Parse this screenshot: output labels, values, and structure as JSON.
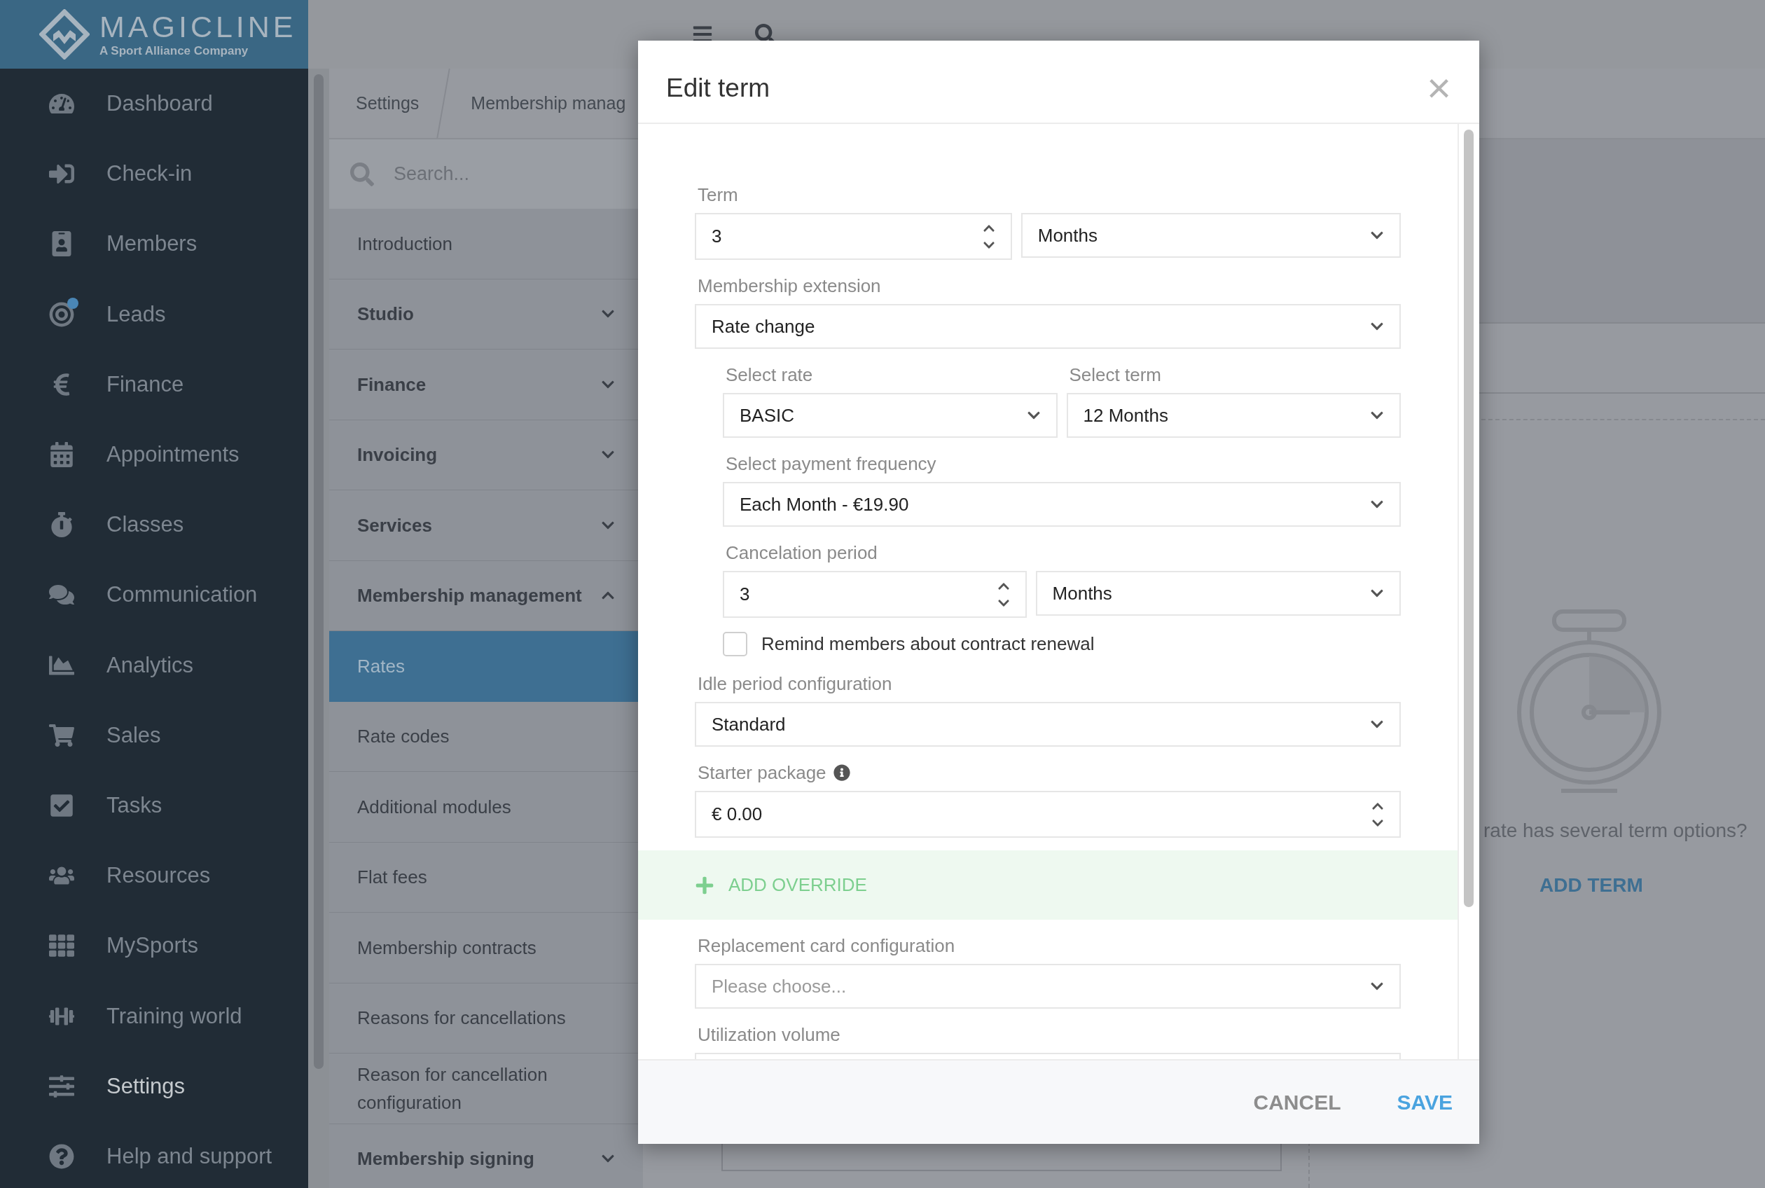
{
  "brand": {
    "name": "MAGICLINE",
    "tagline": "A Sport Alliance Company"
  },
  "sidebar": {
    "items": [
      {
        "label": "Dashboard",
        "selected": false,
        "notification": false
      },
      {
        "label": "Check-in",
        "selected": false,
        "notification": false
      },
      {
        "label": "Members",
        "selected": false,
        "notification": false
      },
      {
        "label": "Leads",
        "selected": false,
        "notification": true
      },
      {
        "label": "Finance",
        "selected": false,
        "notification": false
      },
      {
        "label": "Appointments",
        "selected": false,
        "notification": false
      },
      {
        "label": "Classes",
        "selected": false,
        "notification": false
      },
      {
        "label": "Communication",
        "selected": false,
        "notification": false
      },
      {
        "label": "Analytics",
        "selected": false,
        "notification": false
      },
      {
        "label": "Sales",
        "selected": false,
        "notification": false
      },
      {
        "label": "Tasks",
        "selected": false,
        "notification": false
      },
      {
        "label": "Resources",
        "selected": false,
        "notification": false
      },
      {
        "label": "MySports",
        "selected": false,
        "notification": false
      },
      {
        "label": "Training world",
        "selected": false,
        "notification": false
      },
      {
        "label": "Settings",
        "selected": true,
        "notification": false
      },
      {
        "label": "Help and support",
        "selected": false,
        "notification": false
      }
    ]
  },
  "breadcrumb": [
    "Settings",
    "Membership manag"
  ],
  "settings_nav": {
    "search": {
      "placeholder": "Search..."
    },
    "items": [
      {
        "label": "Introduction",
        "kind": "link",
        "selected": false
      },
      {
        "label": "Studio",
        "kind": "group",
        "selected": false,
        "expanded": false
      },
      {
        "label": "Finance",
        "kind": "group",
        "selected": false,
        "expanded": false
      },
      {
        "label": "Invoicing",
        "kind": "group",
        "selected": false,
        "expanded": false
      },
      {
        "label": "Services",
        "kind": "group",
        "selected": false,
        "expanded": false
      },
      {
        "label": "Membership management",
        "kind": "group",
        "selected": false,
        "expanded": true
      },
      {
        "label": "Rates",
        "kind": "link",
        "selected": true
      },
      {
        "label": "Rate codes",
        "kind": "link",
        "selected": false
      },
      {
        "label": "Additional modules",
        "kind": "link",
        "selected": false
      },
      {
        "label": "Flat fees",
        "kind": "link",
        "selected": false
      },
      {
        "label": "Membership contracts",
        "kind": "link",
        "selected": false
      },
      {
        "label": "Reasons for cancellations",
        "kind": "link",
        "selected": false
      },
      {
        "label": "Reason for cancellation configuration",
        "kind": "link",
        "selected": false
      },
      {
        "label": "Membership signing",
        "kind": "group",
        "selected": false,
        "expanded": false
      }
    ]
  },
  "main": {
    "prompt": "rate has several term options?",
    "add_term": "ADD TERM"
  },
  "modal": {
    "title": "Edit term",
    "close": "×",
    "fields": [
      {
        "kind": "number_unit",
        "label": "Term",
        "value": "3",
        "unit": "Months"
      },
      {
        "kind": "select",
        "label": "Membership extension",
        "value": "Rate change",
        "children": [
          {
            "kind": "pair",
            "fields": [
              {
                "label": "Select rate",
                "value": "BASIC"
              },
              {
                "label": "Select term",
                "value": "12 Months"
              }
            ]
          },
          {
            "kind": "select",
            "label": "Select payment frequency",
            "value": "Each Month - €19.90"
          },
          {
            "kind": "number_unit",
            "label": "Cancelation period",
            "value": "3",
            "unit": "Months"
          },
          {
            "kind": "checkbox",
            "label": "Remind members about contract renewal",
            "checked": false
          }
        ]
      },
      {
        "kind": "select",
        "label": "Idle period configuration",
        "value": "Standard"
      },
      {
        "kind": "number",
        "label": "Starter package",
        "value": "€ 0.00",
        "info": true
      },
      {
        "kind": "action",
        "label": "ADD OVERRIDE"
      },
      {
        "kind": "select",
        "label": "Replacement card configuration",
        "placeholder": "Please choose..."
      },
      {
        "kind": "number",
        "label": "Utilization volume"
      }
    ],
    "buttons": [
      {
        "label": "CANCEL",
        "kind": "secondary"
      },
      {
        "label": "SAVE",
        "kind": "primary"
      }
    ]
  }
}
